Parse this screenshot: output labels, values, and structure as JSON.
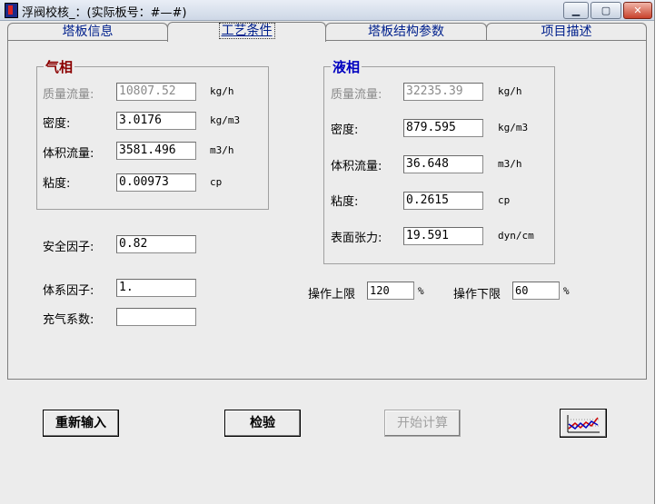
{
  "window": {
    "title": "浮阀校核_：(实际板号：#—#)"
  },
  "tabs": [
    {
      "label": "塔板信息"
    },
    {
      "label": "工艺条件"
    },
    {
      "label": "塔板结构参数"
    },
    {
      "label": "项目描述"
    }
  ],
  "gas": {
    "title": "气相",
    "rows": [
      {
        "label": "质量流量:",
        "value": "10807.52",
        "unit": "kg/h"
      },
      {
        "label": "密度:",
        "value": "3.0176",
        "unit": "kg/m3"
      },
      {
        "label": "体积流量:",
        "value": "3581.496",
        "unit": "m3/h"
      },
      {
        "label": "粘度:",
        "value": "0.00973",
        "unit": "cp"
      }
    ]
  },
  "liquid": {
    "title": "液相",
    "rows": [
      {
        "label": "质量流量:",
        "value": "32235.39",
        "unit": "kg/h"
      },
      {
        "label": "密度:",
        "value": "879.595",
        "unit": "kg/m3"
      },
      {
        "label": "体积流量:",
        "value": "36.648",
        "unit": "m3/h"
      },
      {
        "label": "粘度:",
        "value": "0.2615",
        "unit": "cp"
      },
      {
        "label": "表面张力:",
        "value": "19.591",
        "unit": "dyn/cm"
      }
    ]
  },
  "factors": {
    "safety_label": "安全因子:",
    "safety_value": "0.82",
    "system_label": "体系因子:",
    "system_value": "1.",
    "aeration_label": "充气系数:",
    "aeration_value": ""
  },
  "operation": {
    "upper_label": "操作上限",
    "upper_value": "120",
    "upper_unit": "%",
    "lower_label": "操作下限",
    "lower_value": "60",
    "lower_unit": "%"
  },
  "buttons": {
    "reset": "重新输入",
    "check": "检验",
    "start": "开始计算",
    "chart_icon": "line-chart-icon"
  },
  "colors": {
    "gas_title": "#8b0000",
    "liquid_title": "#0000c0",
    "tab_text": "#00208c"
  }
}
